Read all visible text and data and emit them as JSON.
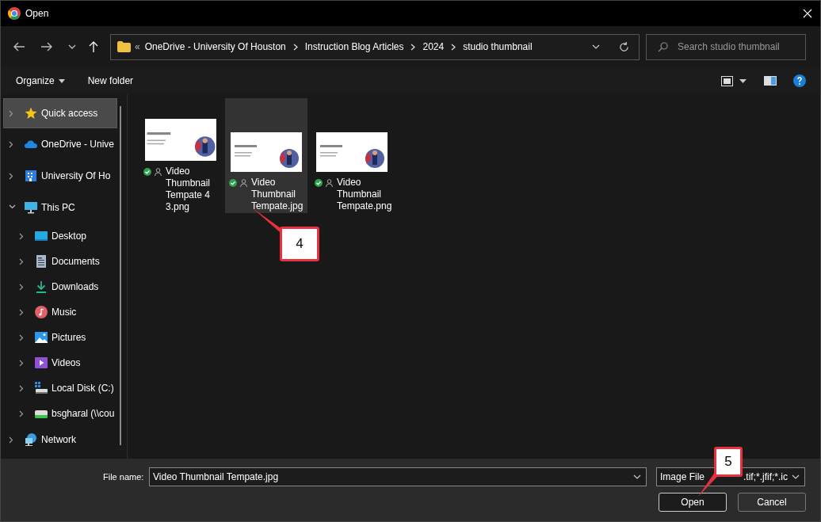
{
  "window": {
    "title": "Open"
  },
  "address_bar": {
    "overflow": "«",
    "path": [
      "OneDrive - University Of Houston",
      "Instruction Blog Articles",
      "2024",
      "studio thumbnail"
    ]
  },
  "search": {
    "placeholder": "Search studio thumbnail"
  },
  "toolbar": {
    "organize": "Organize",
    "new_folder": "New folder"
  },
  "sidebar": {
    "items": [
      {
        "label": "Quick access",
        "selected": true,
        "expanded": false
      },
      {
        "label": "OneDrive - Unive",
        "selected": false,
        "expanded": false
      },
      {
        "label": "University Of Ho",
        "selected": false,
        "expanded": false
      },
      {
        "label": "This PC",
        "selected": false,
        "expanded": true,
        "children": [
          {
            "label": "Desktop",
            "selected": false,
            "expanded": false
          },
          {
            "label": "Documents",
            "selected": false,
            "expanded": false
          },
          {
            "label": "Downloads",
            "selected": false,
            "expanded": false
          },
          {
            "label": "Music",
            "selected": false,
            "expanded": false
          },
          {
            "label": "Pictures",
            "selected": false,
            "expanded": false
          },
          {
            "label": "Videos",
            "selected": false,
            "expanded": false
          },
          {
            "label": "Local Disk (C:)",
            "selected": false,
            "expanded": false
          },
          {
            "label": "bsgharal (\\\\cou",
            "selected": false,
            "expanded": false
          }
        ]
      },
      {
        "label": "Network",
        "selected": false,
        "expanded": false
      }
    ]
  },
  "files": [
    {
      "name": "Video Thumbnail Tempate 4 3.png",
      "selected": false,
      "kind": "picture",
      "synced": true
    },
    {
      "name": "Video Thumbnail Tempate.jpg",
      "selected": true,
      "kind": "picture",
      "synced": true
    },
    {
      "name": "Video Thumbnail Tempate.png",
      "selected": false,
      "kind": "picture",
      "synced": true
    }
  ],
  "footer": {
    "file_name_label": "File name:",
    "file_name_value": "Video Thumbnail Tempate.jpg",
    "filter_parts": [
      "Image File",
      ".tif;*.jfif;*.ic"
    ],
    "open": "Open",
    "cancel": "Cancel"
  },
  "annotations": [
    {
      "label": "4"
    },
    {
      "label": "5"
    }
  ]
}
